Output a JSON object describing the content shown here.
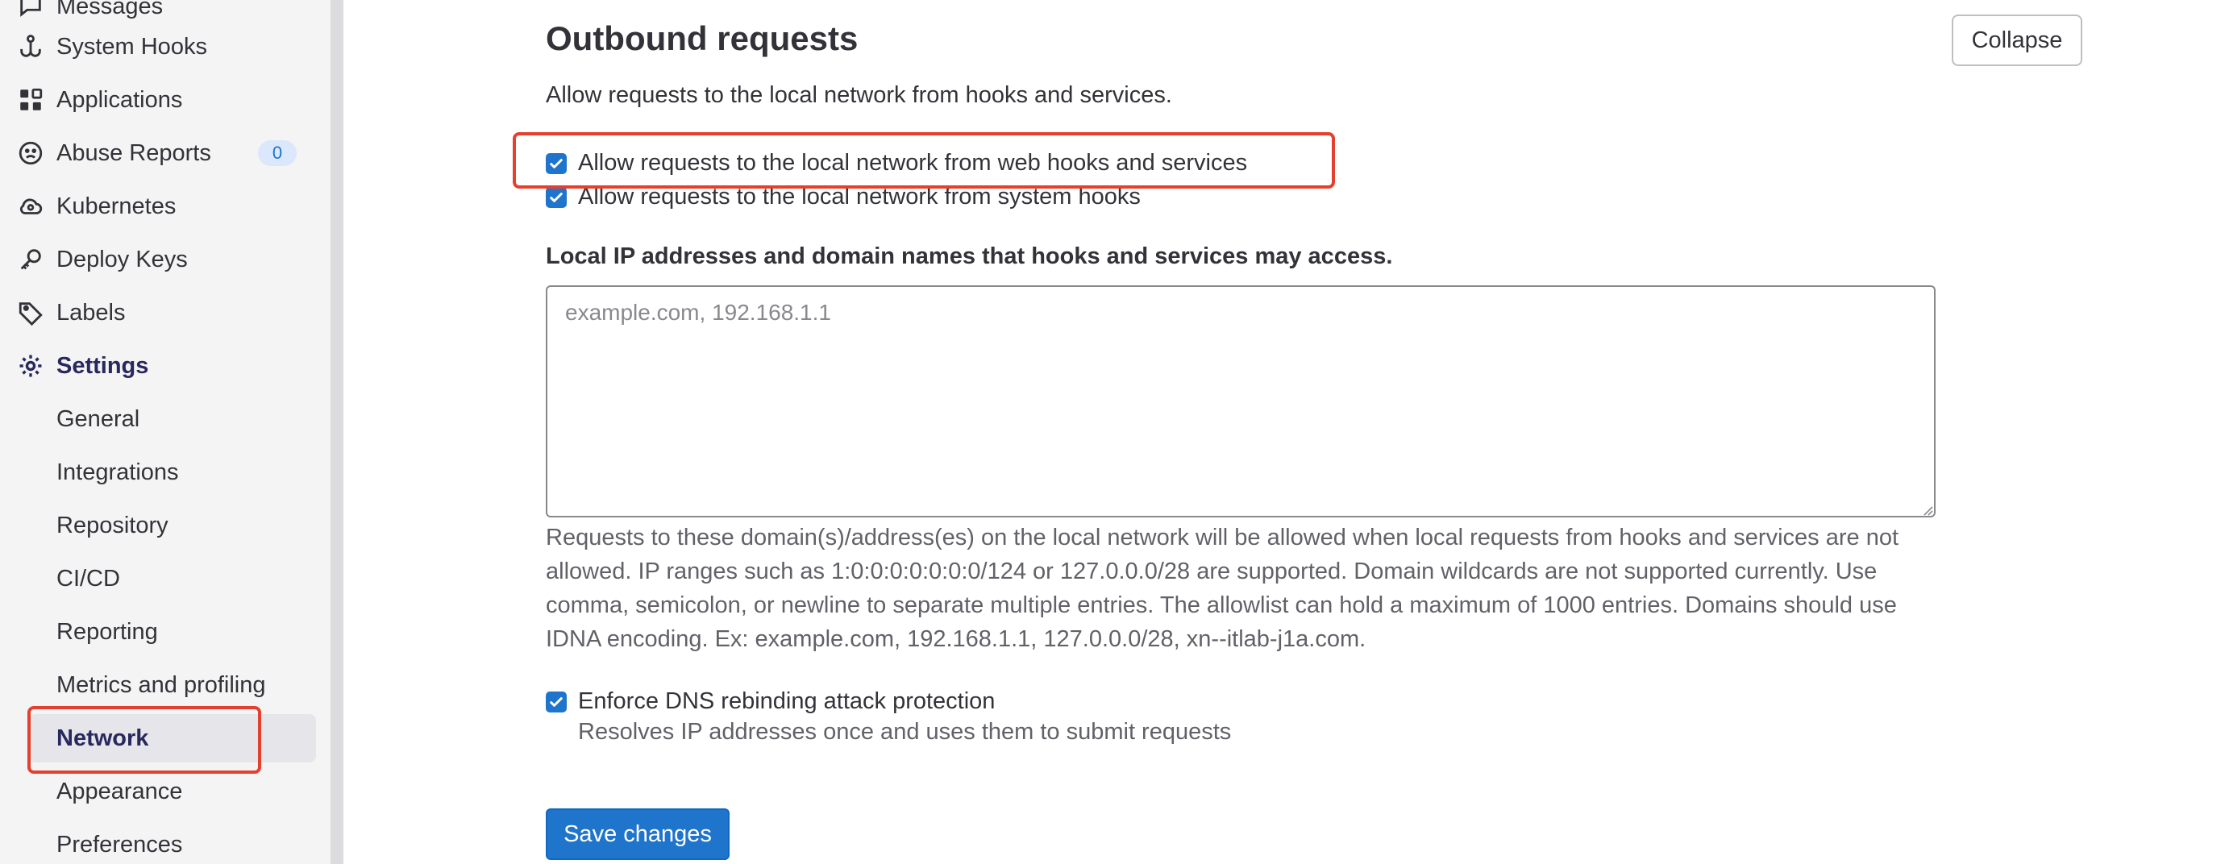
{
  "sidebar": {
    "items": [
      {
        "label": "Messages",
        "icon": "messages-icon"
      },
      {
        "label": "System Hooks",
        "icon": "hook-icon"
      },
      {
        "label": "Applications",
        "icon": "applications-icon"
      },
      {
        "label": "Abuse Reports",
        "icon": "abuse-icon",
        "badge": "0"
      },
      {
        "label": "Kubernetes",
        "icon": "kubernetes-icon"
      },
      {
        "label": "Deploy Keys",
        "icon": "key-icon"
      },
      {
        "label": "Labels",
        "icon": "label-icon"
      },
      {
        "label": "Settings",
        "icon": "gear-icon"
      }
    ],
    "settings_items": [
      {
        "label": "General"
      },
      {
        "label": "Integrations"
      },
      {
        "label": "Repository"
      },
      {
        "label": "CI/CD"
      },
      {
        "label": "Reporting"
      },
      {
        "label": "Metrics and profiling"
      },
      {
        "label": "Network"
      },
      {
        "label": "Appearance"
      },
      {
        "label": "Preferences"
      }
    ]
  },
  "section": {
    "title": "Outbound requests",
    "collapse_label": "Collapse",
    "description": "Allow requests to the local network from hooks and services.",
    "checkbox_web_hooks": {
      "label": "Allow requests to the local network from web hooks and services",
      "checked": true
    },
    "checkbox_system_hooks": {
      "label": "Allow requests to the local network from system hooks",
      "checked": true
    },
    "allowlist_label": "Local IP addresses and domain names that hooks and services may access.",
    "allowlist_placeholder": "example.com, 192.168.1.1",
    "allowlist_value": "",
    "allowlist_help": "Requests to these domain(s)/address(es) on the local network will be allowed when local requests from hooks and services are not allowed. IP ranges such as 1:0:0:0:0:0:0:0/124 or 127.0.0.0/28 are supported. Domain wildcards are not supported currently. Use comma, semicolon, or newline to separate multiple entries. The allowlist can hold a maximum of 1000 entries. Domains should use IDNA encoding. Ex: example.com, 192.168.1.1, 127.0.0.0/28, xn--itlab-j1a.com.",
    "checkbox_dns": {
      "label": "Enforce DNS rebinding attack protection",
      "checked": true
    },
    "dns_help": "Resolves IP addresses once and uses them to submit requests",
    "save_label": "Save changes"
  },
  "colors": {
    "accent": "#1f75cb",
    "highlight": "#e53f2d",
    "sidebar_bg": "#f4f4f5",
    "active_text": "#28285e"
  }
}
